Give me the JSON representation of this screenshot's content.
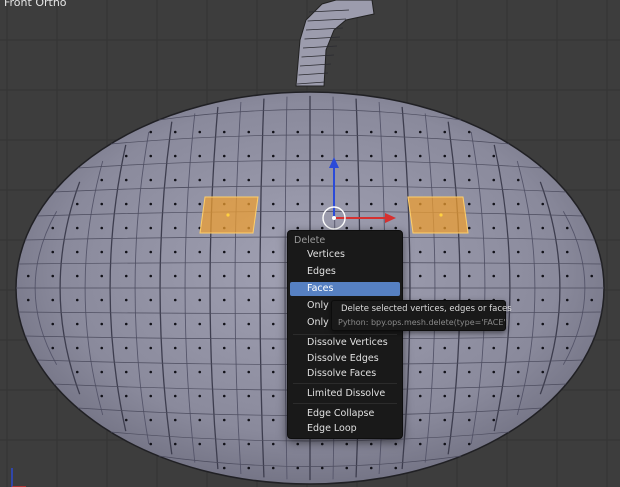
{
  "viewport": {
    "label": "Front Ortho"
  },
  "menu": {
    "title": "Delete",
    "items": [
      {
        "label": "Vertices",
        "active": false
      },
      {
        "label": "Edges",
        "active": false
      },
      {
        "label": "Faces",
        "active": true
      },
      {
        "label": "Only Edges & Faces",
        "visible_text": "Only E",
        "active": false
      },
      {
        "label": "Only Faces",
        "visible_text": "Only F",
        "active": false
      },
      {
        "label": "Dissolve Vertices",
        "active": false
      },
      {
        "label": "Dissolve Edges",
        "active": false
      },
      {
        "label": "Dissolve Faces",
        "active": false
      },
      {
        "label": "Limited Dissolve",
        "active": false
      },
      {
        "label": "Edge Collapse",
        "active": false
      },
      {
        "label": "Edge Loop",
        "active": false
      }
    ]
  },
  "tooltip": {
    "description": "Delete selected vertices, edges or faces",
    "python": "Python: bpy.ops.mesh.delete(type='FACE')"
  },
  "colors": {
    "background": "#3d3d3d",
    "grid": "#333333",
    "mesh": "#8d8da1",
    "selection": "#f0a030",
    "menu_bg": "#191919",
    "highlight": "#5680c2",
    "axis_x": "#d63030",
    "axis_z": "#2b4bd8"
  }
}
